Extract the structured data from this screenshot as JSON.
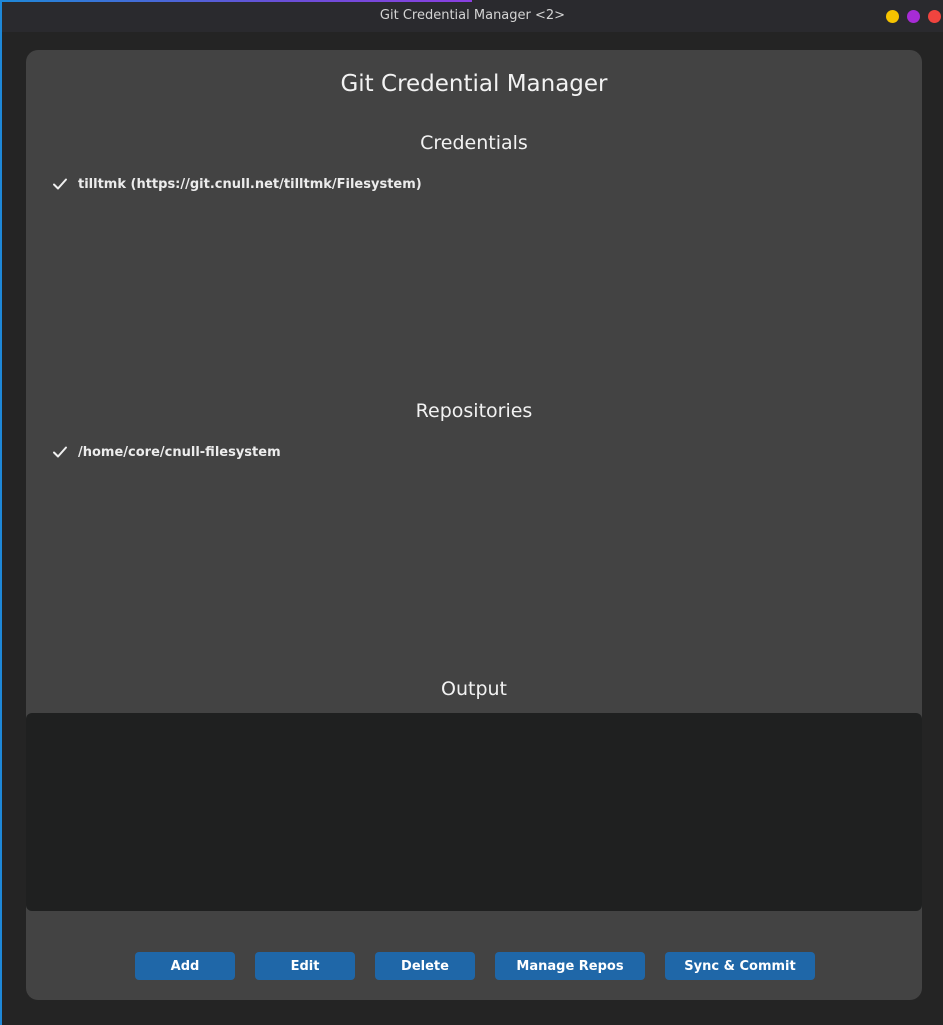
{
  "window": {
    "title": "Git Credential Manager <2>"
  },
  "app": {
    "title": "Git Credential Manager"
  },
  "credentials": {
    "heading": "Credentials",
    "items": [
      {
        "label": "tilltmk (https://git.cnull.net/tilltmk/Filesystem)",
        "checked": true,
        "icon": "checkmark-icon"
      }
    ]
  },
  "repositories": {
    "heading": "Repositories",
    "items": [
      {
        "label": "/home/core/cnull-filesystem",
        "checked": true,
        "icon": "checkmark-icon"
      }
    ]
  },
  "output": {
    "heading": "Output",
    "value": ""
  },
  "actions": {
    "add": "Add",
    "edit": "Edit",
    "delete": "Delete",
    "manage_repos": "Manage Repos",
    "sync_commit": "Sync & Commit"
  },
  "colors": {
    "panel": "#434343",
    "output_bg": "#1f2020",
    "button": "#1f67a8",
    "minimize": "#f5c300",
    "maximize": "#a72bd6",
    "close": "#f0443f"
  }
}
